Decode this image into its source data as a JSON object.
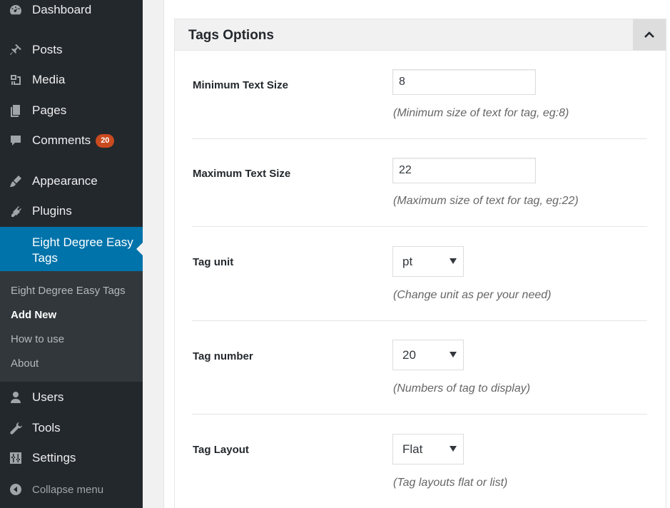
{
  "sidebar": {
    "items": [
      {
        "label": "Dashboard",
        "icon": "dashboard-icon"
      },
      {
        "label": "Posts",
        "icon": "pin-icon"
      },
      {
        "label": "Media",
        "icon": "media-icon"
      },
      {
        "label": "Pages",
        "icon": "pages-icon"
      },
      {
        "label": "Comments",
        "icon": "comment-icon",
        "badge": "20"
      },
      {
        "label": "Appearance",
        "icon": "brush-icon"
      },
      {
        "label": "Plugins",
        "icon": "plug-icon"
      },
      {
        "label": "Eight Degree Easy Tags",
        "icon": "tag-icon"
      }
    ],
    "submenu": [
      "Eight Degree Easy Tags",
      "Add New",
      "How to use",
      "About"
    ],
    "lower_items": [
      {
        "label": "Users",
        "icon": "user-icon"
      },
      {
        "label": "Tools",
        "icon": "wrench-icon"
      },
      {
        "label": "Settings",
        "icon": "settings-icon"
      }
    ],
    "collapse_label": "Collapse menu"
  },
  "panel": {
    "title": "Tags Options",
    "rows": [
      {
        "label": "Minimum Text Size",
        "value": "8",
        "description": "(Minimum size of text for tag, eg:8)"
      },
      {
        "label": "Maximum Text Size",
        "value": "22",
        "description": "(Maximum size of text for tag, eg:22)"
      },
      {
        "label": "Tag unit",
        "value": "pt",
        "description": "(Change unit as per your need)"
      },
      {
        "label": "Tag number",
        "value": "20",
        "description": "(Numbers of tag to display)"
      },
      {
        "label": "Tag Layout",
        "value": "Flat",
        "description": "(Tag layouts flat or list)"
      }
    ]
  },
  "colors": {
    "sidebar_bg": "#23282d",
    "submenu_bg": "#32373c",
    "active_bg": "#0073aa",
    "badge_bg": "#ca4a1f"
  }
}
